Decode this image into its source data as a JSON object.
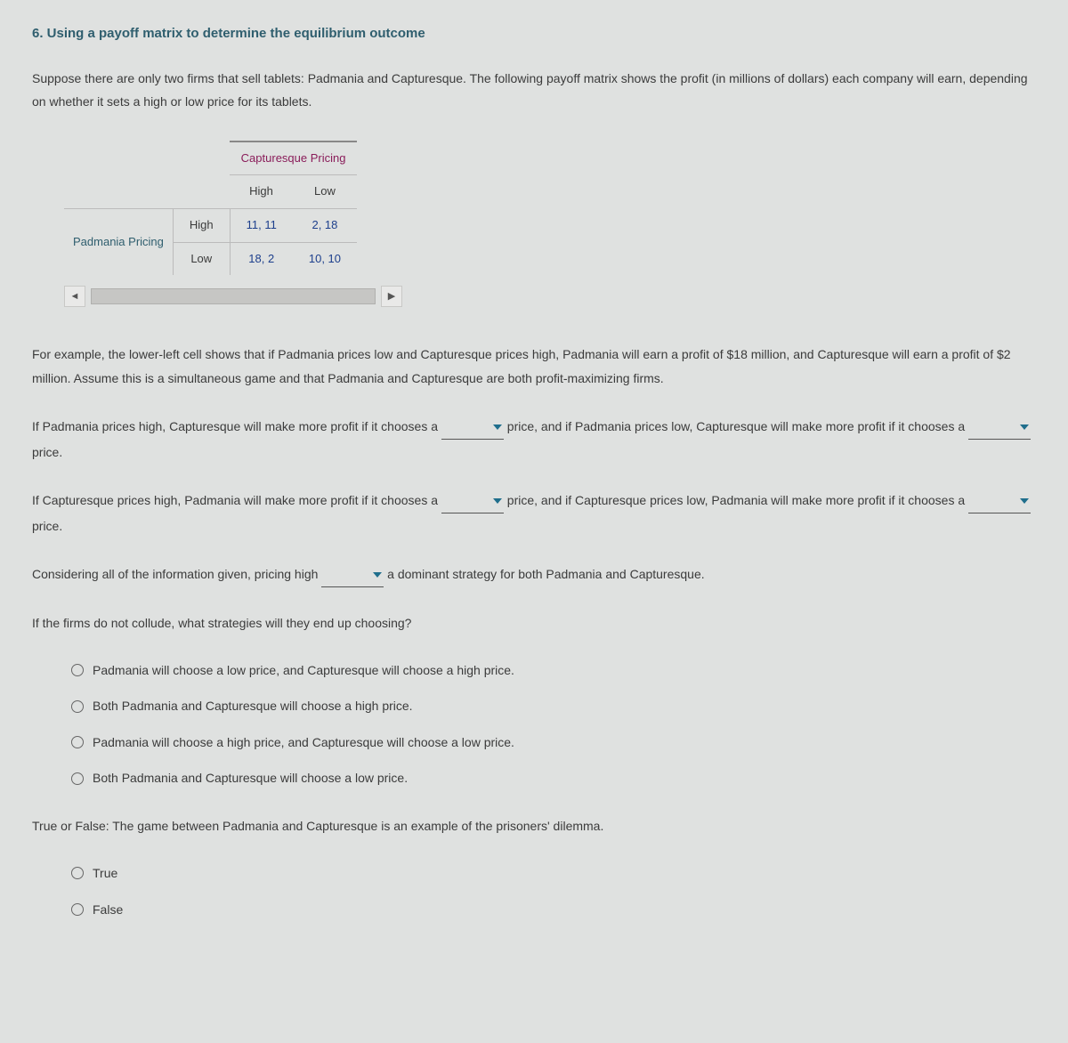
{
  "title": "6. Using a payoff matrix to determine the equilibrium outcome",
  "intro": "Suppose there are only two firms that sell tablets: Padmania and Capturesque. The following payoff matrix shows the profit (in millions of dollars) each company will earn, depending on whether it sets a high or low price for its tablets.",
  "matrix": {
    "col_player": "Capturesque Pricing",
    "row_player": "Padmania Pricing",
    "cols": {
      "high": "High",
      "low": "Low"
    },
    "rows": {
      "high": "High",
      "low": "Low"
    },
    "cells": {
      "hh": "11, 11",
      "hl": "2, 18",
      "lh": "18, 2",
      "ll": "10, 10"
    }
  },
  "example": "For example, the lower-left cell shows that if Padmania prices low and Capturesque prices high, Padmania will earn a profit of $18 million, and Capturesque will earn a profit of $2 million. Assume this is a simultaneous game and that Padmania and Capturesque are both profit-maximizing firms.",
  "q1": {
    "p1a": "If Padmania prices high, Capturesque will make more profit if it chooses a ",
    "p1b": " price, and if Padmania prices low, Capturesque will make more profit if it chooses a ",
    "p1c": " price."
  },
  "q2": {
    "p2a": "If Capturesque prices high, Padmania will make more profit if it chooses a ",
    "p2b": " price, and if Capturesque prices low, Padmania will make more profit if it chooses a ",
    "p2c": " price."
  },
  "q3": {
    "p3a": "Considering all of the information given, pricing high ",
    "p3b": " a dominant strategy for both Padmania and Capturesque."
  },
  "q4": {
    "prompt": "If the firms do not collude, what strategies will they end up choosing?",
    "options": [
      "Padmania will choose a low price, and Capturesque will choose a high price.",
      "Both Padmania and Capturesque will choose a high price.",
      "Padmania will choose a high price, and Capturesque will choose a low price.",
      "Both Padmania and Capturesque will choose a low price."
    ]
  },
  "q5": {
    "prompt": "True or False: The game between Padmania and Capturesque is an example of the prisoners' dilemma.",
    "options": [
      "True",
      "False"
    ]
  }
}
